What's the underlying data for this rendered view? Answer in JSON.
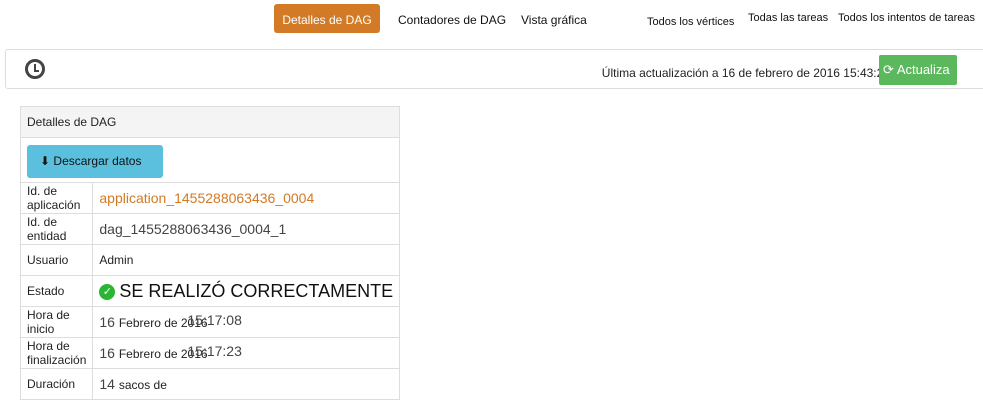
{
  "nav": {
    "tabs": [
      {
        "label": "Detalles de DAG",
        "active": true
      },
      {
        "label": "Contadores de DAG"
      },
      {
        "label": "Vista gráfica"
      }
    ],
    "links": [
      {
        "label": "Todos los vértices"
      },
      {
        "label": "Todas las tareas"
      },
      {
        "label": "Todos los intentos de tareas"
      }
    ]
  },
  "toolbar": {
    "last_update": "Última actualización a 16 de febrero de 2016 15:43:28",
    "refresh_label": "Actualiza",
    "refresh_icon": "refresh-icon",
    "clock_icon": "clock-icon"
  },
  "details": {
    "title": "Detalles de DAG",
    "download_label": "Descargar datos",
    "rows": [
      {
        "label": "Id. de aplicación",
        "value": "application_1455288063436_0004"
      },
      {
        "label": "Id. de entidad",
        "value": "dag_1455288063436_0004_1"
      },
      {
        "label": "Usuario",
        "value": "Admin"
      },
      {
        "label": "Estado",
        "value": "SE REALIZÓ CORRECTAMENTE"
      },
      {
        "label": "Hora de inicio",
        "day": "16",
        "date": "Febrero de 2016",
        "time": "15:17:08"
      },
      {
        "label": "Hora de finalización",
        "day": "16",
        "date": "Febrero de 2016",
        "time": "15:17:23"
      },
      {
        "label": "Duración",
        "day": "14",
        "date": "sacos de"
      }
    ]
  },
  "colors": {
    "accent": "#d27a25",
    "success": "#5cb85c",
    "info": "#5bc0de"
  }
}
